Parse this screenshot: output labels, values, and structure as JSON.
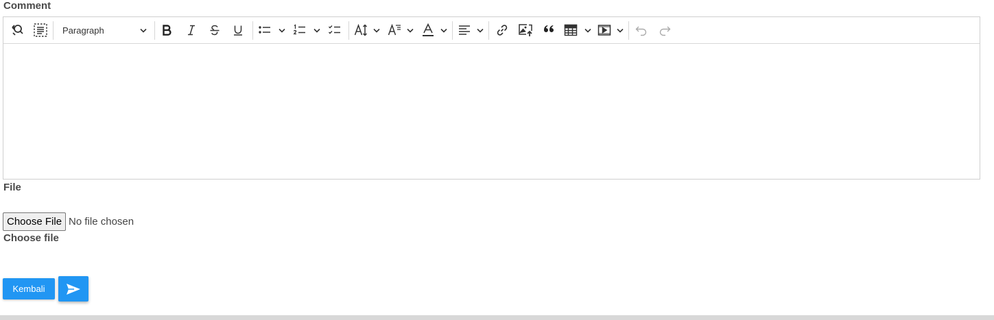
{
  "form": {
    "comment_label": "Comment",
    "file_label": "File",
    "choose_file_caption": "Choose file"
  },
  "editor": {
    "toolbar": {
      "paragraph_select": "Paragraph",
      "buttons": [
        "find-replace",
        "show-blocks",
        "heading",
        "bold",
        "italic",
        "strikethrough",
        "underline",
        "bulleted-list",
        "numbered-list",
        "todo-list",
        "font-size",
        "font-family",
        "font-color",
        "alignment",
        "link",
        "insert-image",
        "block-quote",
        "insert-table",
        "media-embed",
        "undo",
        "redo"
      ]
    },
    "content": ""
  },
  "file_input": {
    "button_label": "Choose File",
    "status": "No file chosen"
  },
  "actions": {
    "back_label": "Kembali",
    "send_icon": "send-icon"
  },
  "colors": {
    "accent": "#2196f3",
    "label": "#4a4a4a",
    "border": "#cfcfcf"
  }
}
